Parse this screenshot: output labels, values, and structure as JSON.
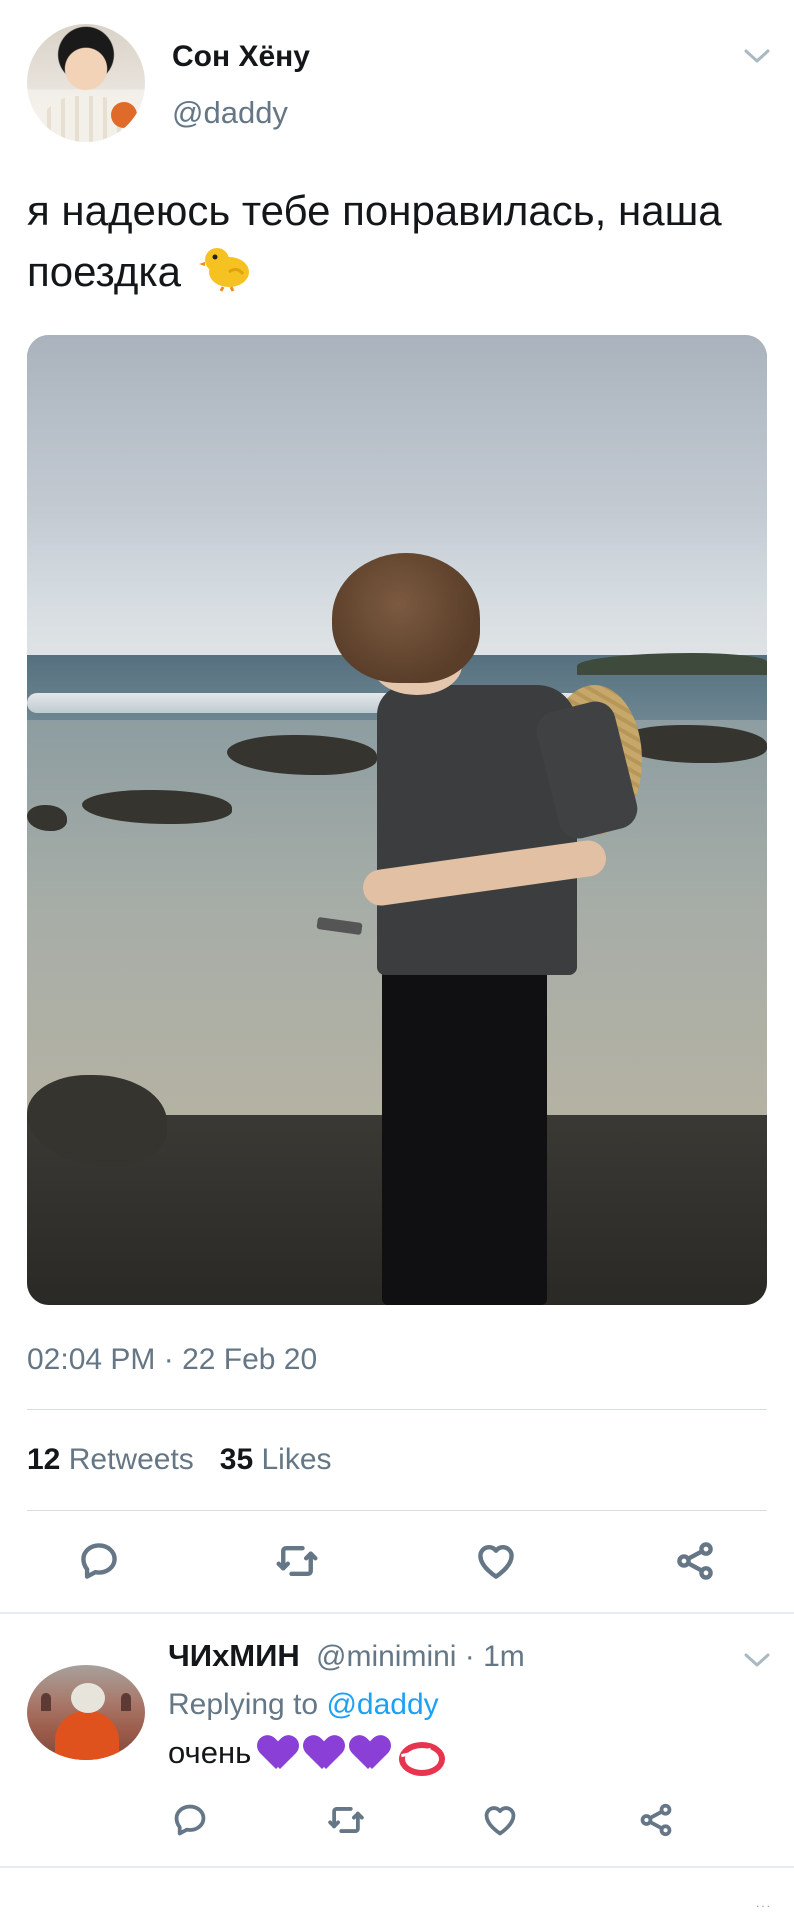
{
  "tweet": {
    "author_name": "Сон Хёну",
    "author_handle": "@daddy",
    "text": "я надеюсь тебе понравилась, наша поездка",
    "text_emoji": "chick-emoji",
    "timestamp": "02:04 PM · 22 Feb 20",
    "retweets_count": "12",
    "retweets_label": "Retweets",
    "likes_count": "35",
    "likes_label": "Likes",
    "actions": [
      "reply-icon",
      "retweet-icon",
      "like-icon",
      "share-icon"
    ]
  },
  "reply": {
    "author_name": "ЧИхМИН",
    "meta": "@minimini · 1m",
    "replying_prefix": "Replying to",
    "replying_to": "@daddy",
    "text": "очень",
    "emojis": [
      "purple-heart-emoji",
      "purple-heart-emoji",
      "purple-heart-emoji",
      "kiss-mark-emoji"
    ],
    "actions": [
      "reply-icon",
      "retweet-icon",
      "like-icon",
      "share-icon"
    ]
  },
  "colors": {
    "text_primary": "#14171a",
    "text_secondary": "#657786",
    "link": "#1da1f2",
    "divider": "#d7dde1",
    "icon": "#657786",
    "purple_heart": "#8a3fd6",
    "kiss": "#e8344e"
  },
  "footer": {
    "more": "..."
  }
}
